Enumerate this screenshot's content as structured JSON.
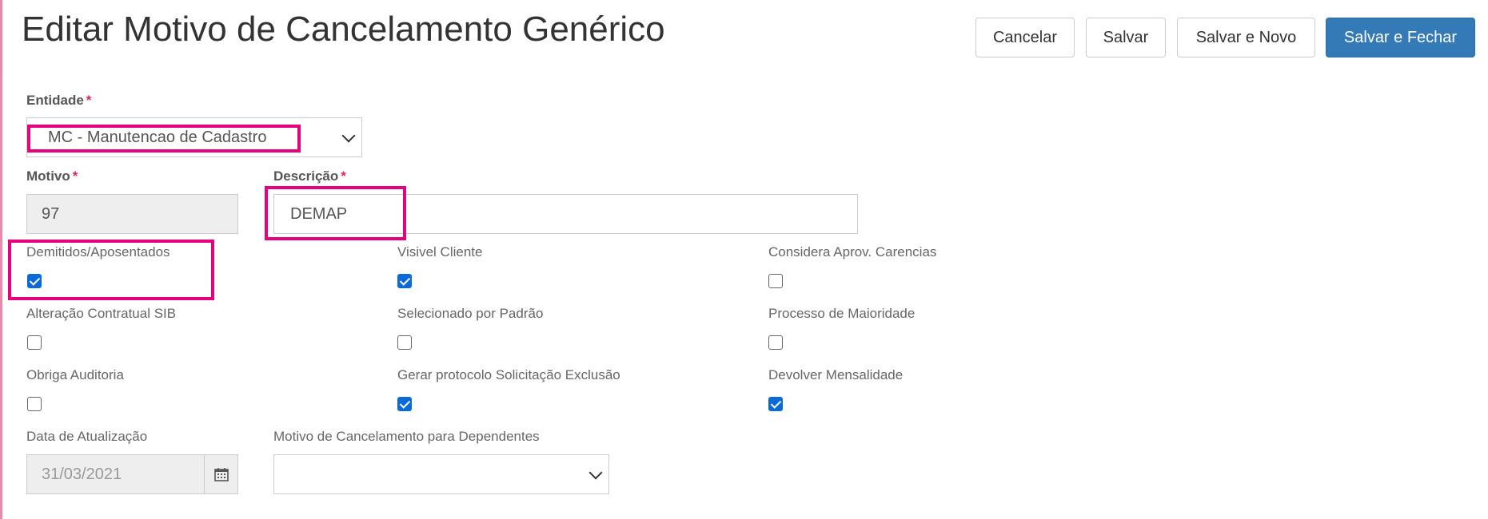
{
  "header": {
    "title": "Editar Motivo de Cancelamento Genérico",
    "buttons": {
      "cancel": "Cancelar",
      "save": "Salvar",
      "save_new": "Salvar e Novo",
      "save_close": "Salvar e Fechar"
    }
  },
  "form": {
    "required_mark": "*",
    "entidade": {
      "label": "Entidade",
      "value": "MC - Manutencao de Cadastro"
    },
    "motivo": {
      "label": "Motivo",
      "value": "97"
    },
    "descricao": {
      "label": "Descrição",
      "value": "DEMAP"
    },
    "checkboxes": [
      {
        "label": "Demitidos/Aposentados",
        "checked": true
      },
      {
        "label": "Visivel Cliente",
        "checked": true
      },
      {
        "label": "Considera Aprov. Carencias",
        "checked": false
      },
      {
        "label": "Alteração Contratual SIB",
        "checked": false
      },
      {
        "label": "Selecionado por Padrão",
        "checked": false
      },
      {
        "label": "Processo de Maioridade",
        "checked": false
      },
      {
        "label": "Obriga Auditoria",
        "checked": false
      },
      {
        "label": "Gerar protocolo Solicitação Exclusão",
        "checked": true
      },
      {
        "label": "Devolver Mensalidade",
        "checked": true
      }
    ],
    "data_atualizacao": {
      "label": "Data de Atualização",
      "value": "31/03/2021"
    },
    "motivo_dependentes": {
      "label": "Motivo de Cancelamento para Dependentes",
      "value": ""
    }
  },
  "colors": {
    "primary": "#337ab7",
    "highlight": "#e6007e",
    "checkbox": "#0b6bd6",
    "required": "#e0245e"
  }
}
